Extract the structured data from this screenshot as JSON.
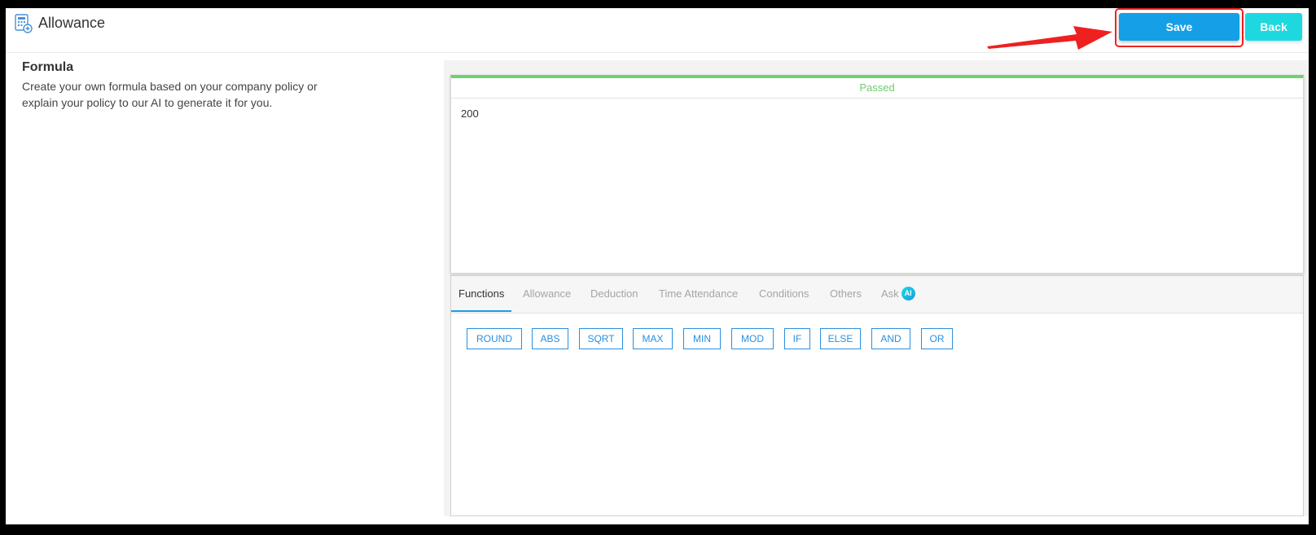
{
  "header": {
    "title": "Allowance",
    "save_label": "Save",
    "back_label": "Back"
  },
  "formula": {
    "title": "Formula",
    "description_line1": "Create your own formula based on your company policy or",
    "description_line2": "explain your policy to our AI to generate it for you.",
    "status": "Passed",
    "value": "200"
  },
  "tabs": [
    {
      "label": "Functions",
      "active": true
    },
    {
      "label": "Allowance",
      "active": false
    },
    {
      "label": "Deduction",
      "active": false
    },
    {
      "label": "Time Attendance",
      "active": false
    },
    {
      "label": "Conditions",
      "active": false
    },
    {
      "label": "Others",
      "active": false
    },
    {
      "label": "Ask",
      "active": false,
      "badge": "AI"
    }
  ],
  "functions": [
    "ROUND",
    "ABS",
    "SQRT",
    "MAX",
    "MIN",
    "MOD",
    "IF",
    "ELSE",
    "AND",
    "OR"
  ],
  "colors": {
    "save": "#149fe6",
    "back": "#1ed8e0",
    "passed": "#6ccf6c",
    "function_border": "#2a8fe0",
    "highlight": "#ee2222"
  },
  "icons": {
    "app": "calculator-icon",
    "ai": "ai-badge-icon",
    "annotation": "red-arrow-icon"
  }
}
